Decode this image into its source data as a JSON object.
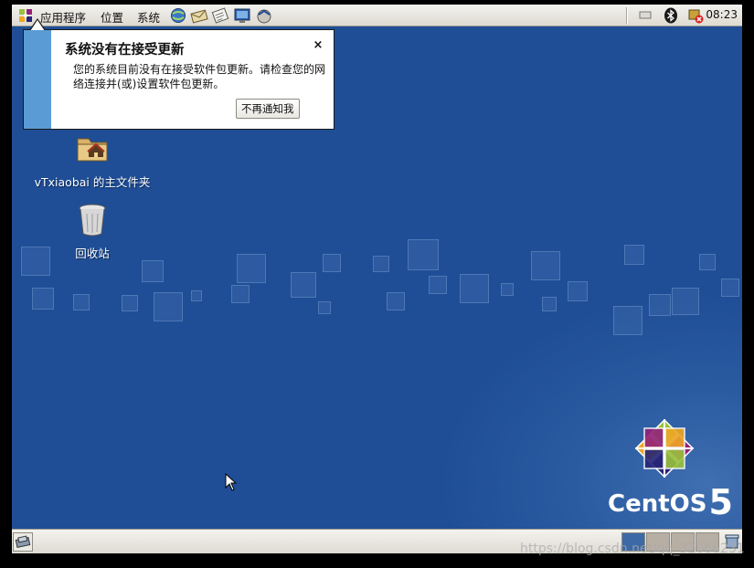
{
  "top_panel": {
    "menus": [
      "应用程序",
      "位置",
      "系统"
    ],
    "launchers": [
      "web-browser-icon",
      "mail-icon",
      "text-editor-icon",
      "screenshot-icon",
      "update-icon"
    ],
    "tray": [
      "keyboard-icon",
      "bluetooth-icon",
      "update-error-icon"
    ],
    "clock": "08:23"
  },
  "notification": {
    "title": "系统没有在接受更新",
    "body": "您的系统目前没有在接受软件包更新。请检查您的网络连接并(或)设置软件包更新。",
    "button": "不再通知我",
    "close": "×"
  },
  "desktop": {
    "icons": [
      {
        "label": "vTxiaobai 的主文件夹",
        "icon": "home-folder-icon"
      },
      {
        "label": "回收站",
        "icon": "trash-icon"
      }
    ],
    "brand": {
      "name": "CentOS",
      "version": "5"
    }
  },
  "bottom_panel": {
    "workspaces": 4,
    "active_workspace": 1,
    "show_desktop": "show-desktop-icon"
  },
  "colors": {
    "desktop": "#1f4e96",
    "notification_stripe": "#5b9bd5",
    "active_workspace": "#3d6aa6",
    "inactive_workspace": "#b7afa4"
  },
  "watermark": "https://blog.csdn.net/qq_32066231"
}
